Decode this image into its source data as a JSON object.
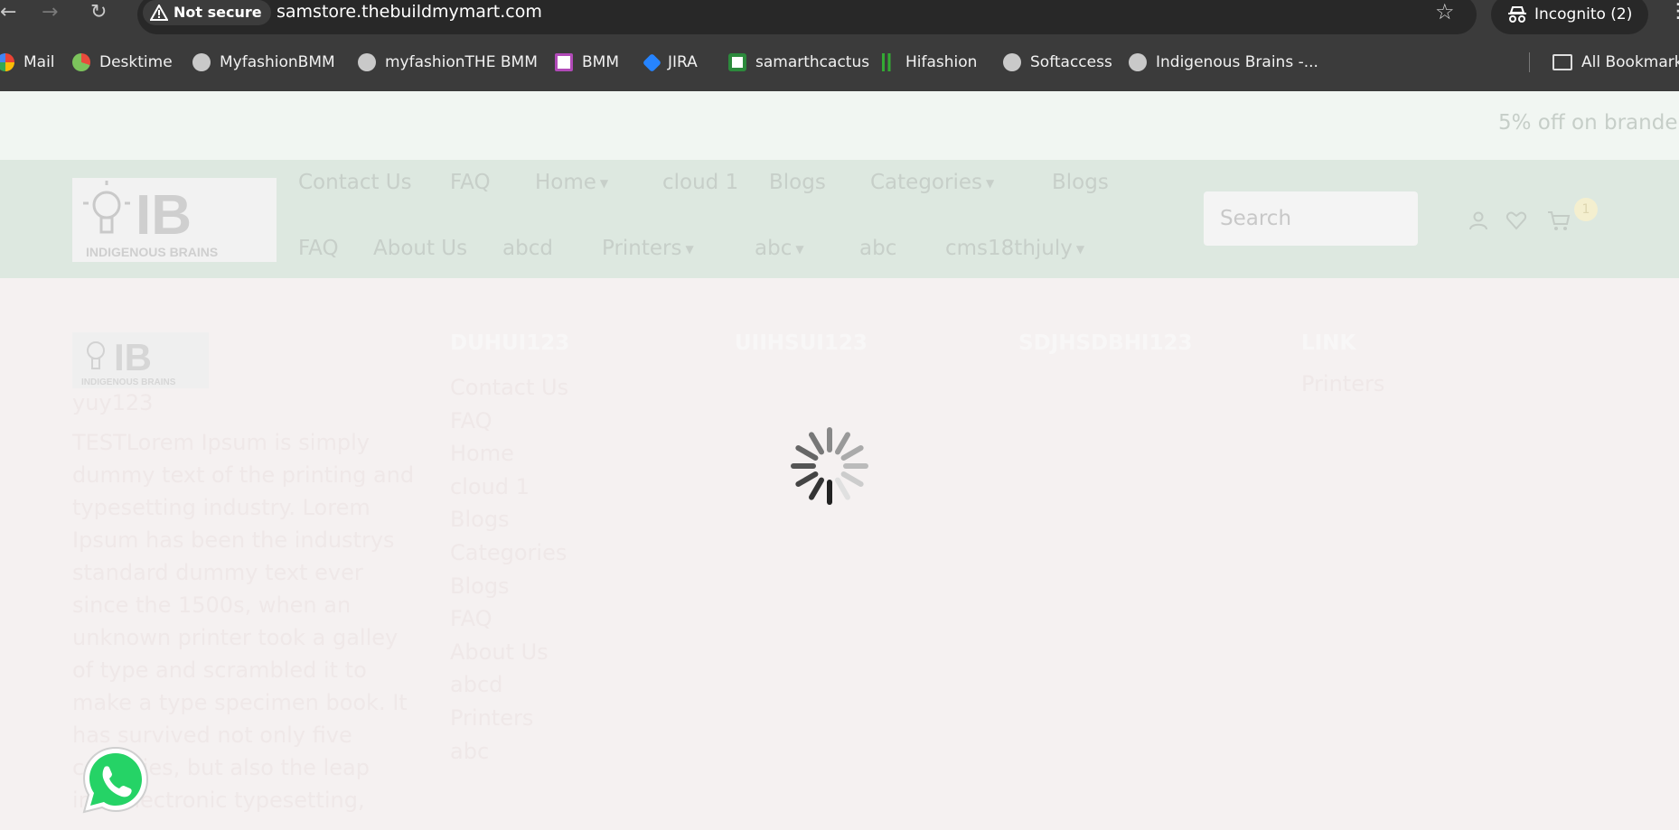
{
  "browser": {
    "security_label": "Not secure",
    "url": "samstore.thebuildmymart.com",
    "incognito_label": "Incognito (2)",
    "bookmarks": [
      "Mail",
      "Desktime",
      "MyfashionBMM",
      "myfashionTHE BMM",
      "BMM",
      "JIRA",
      "samarthcactus",
      "Hifashion",
      "Softaccess",
      "Indigenous Brains -..."
    ],
    "all_bookmarks_label": "All Bookmark"
  },
  "promo": {
    "text": "5% off on brande"
  },
  "header": {
    "logo_letters": "IB",
    "logo_tagline": "INDIGENOUS BRAINS",
    "nav_row1": [
      "Contact Us",
      "FAQ",
      "Home",
      "cloud 1",
      "Blogs",
      "Categories",
      "Blogs"
    ],
    "nav_row2": [
      "FAQ",
      "About Us",
      "abcd",
      "Printers",
      "abc",
      "abc",
      "cms18thjuly"
    ],
    "search_placeholder": "Search",
    "cart_count": "1"
  },
  "footer": {
    "logo_letters": "IB",
    "logo_tagline": "INDIGENOUS BRAINS",
    "subtitle": "yuy123",
    "description": "TESTLorem Ipsum is simply dummy text of the printing and typesetting industry. Lorem Ipsum has been the industrys standard dummy text ever since the 1500s, when an unknown printer took a galley of type and scrambled it to make a type specimen book. It has survived not only five centuries, but also the leap into electronic typesetting,",
    "col_titles": [
      "DUHUI123",
      "UIIHSUI123",
      "SDJHSDBHI123",
      "LINK"
    ],
    "col1_links": [
      "Contact Us",
      "FAQ",
      "Home",
      "cloud 1",
      "Blogs",
      "Categories",
      "Blogs",
      "FAQ",
      "About Us",
      "abcd",
      "Printers",
      "abc"
    ],
    "link_col_items": [
      "Printers"
    ]
  },
  "colors": {
    "chrome_bg": "#3b3b3b",
    "omnibox_bg": "#282828",
    "promo_bg": "#f1f6f2",
    "header_bg": "#dde8e0",
    "page_bg": "#f5f1f1",
    "whatsapp_green": "#25d366"
  }
}
